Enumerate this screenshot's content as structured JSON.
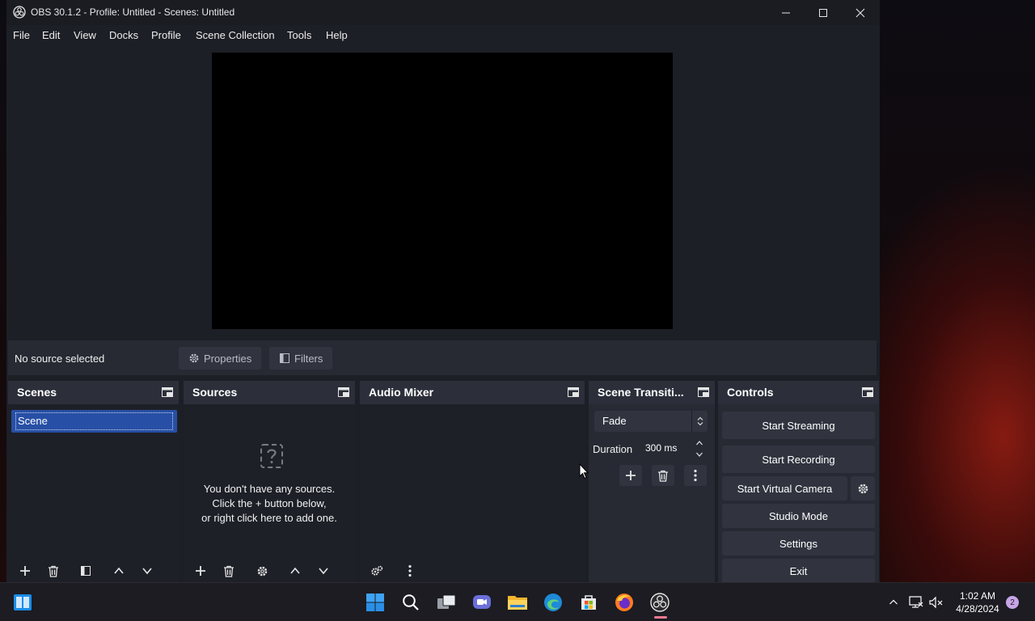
{
  "window": {
    "title": "OBS 30.1.2 - Profile: Untitled - Scenes: Untitled"
  },
  "menu": [
    "File",
    "Edit",
    "View",
    "Docks",
    "Profile",
    "Scene Collection",
    "Tools",
    "Help"
  ],
  "source_bar": {
    "status": "No source selected",
    "properties_label": "Properties",
    "filters_label": "Filters"
  },
  "scenes": {
    "title": "Scenes",
    "items": [
      "Scene"
    ]
  },
  "sources": {
    "title": "Sources",
    "empty_lines": [
      "You don't have any sources.",
      "Click the + button below,",
      "or right click here to add one."
    ]
  },
  "audio_mixer": {
    "title": "Audio Mixer"
  },
  "scene_transitions": {
    "title": "Scene Transiti...",
    "transition": "Fade",
    "duration_label": "Duration",
    "duration_value": "300 ms"
  },
  "controls": {
    "title": "Controls",
    "start_streaming": "Start Streaming",
    "start_recording": "Start Recording",
    "start_virtual_camera": "Start Virtual Camera",
    "studio_mode": "Studio Mode",
    "settings": "Settings",
    "exit": "Exit"
  },
  "taskbar": {
    "time": "1:02 AM",
    "date": "4/28/2024",
    "notification_count": "2",
    "apps": [
      "start-icon",
      "search-icon",
      "task-view-icon",
      "chat-icon",
      "file-explorer-icon",
      "edge-icon",
      "store-icon",
      "firefox-icon",
      "obs-icon"
    ]
  },
  "colors": {
    "dock_bg": "#272a33",
    "selection": "#274fa5",
    "button": "#31343f",
    "preview": "#000000"
  }
}
